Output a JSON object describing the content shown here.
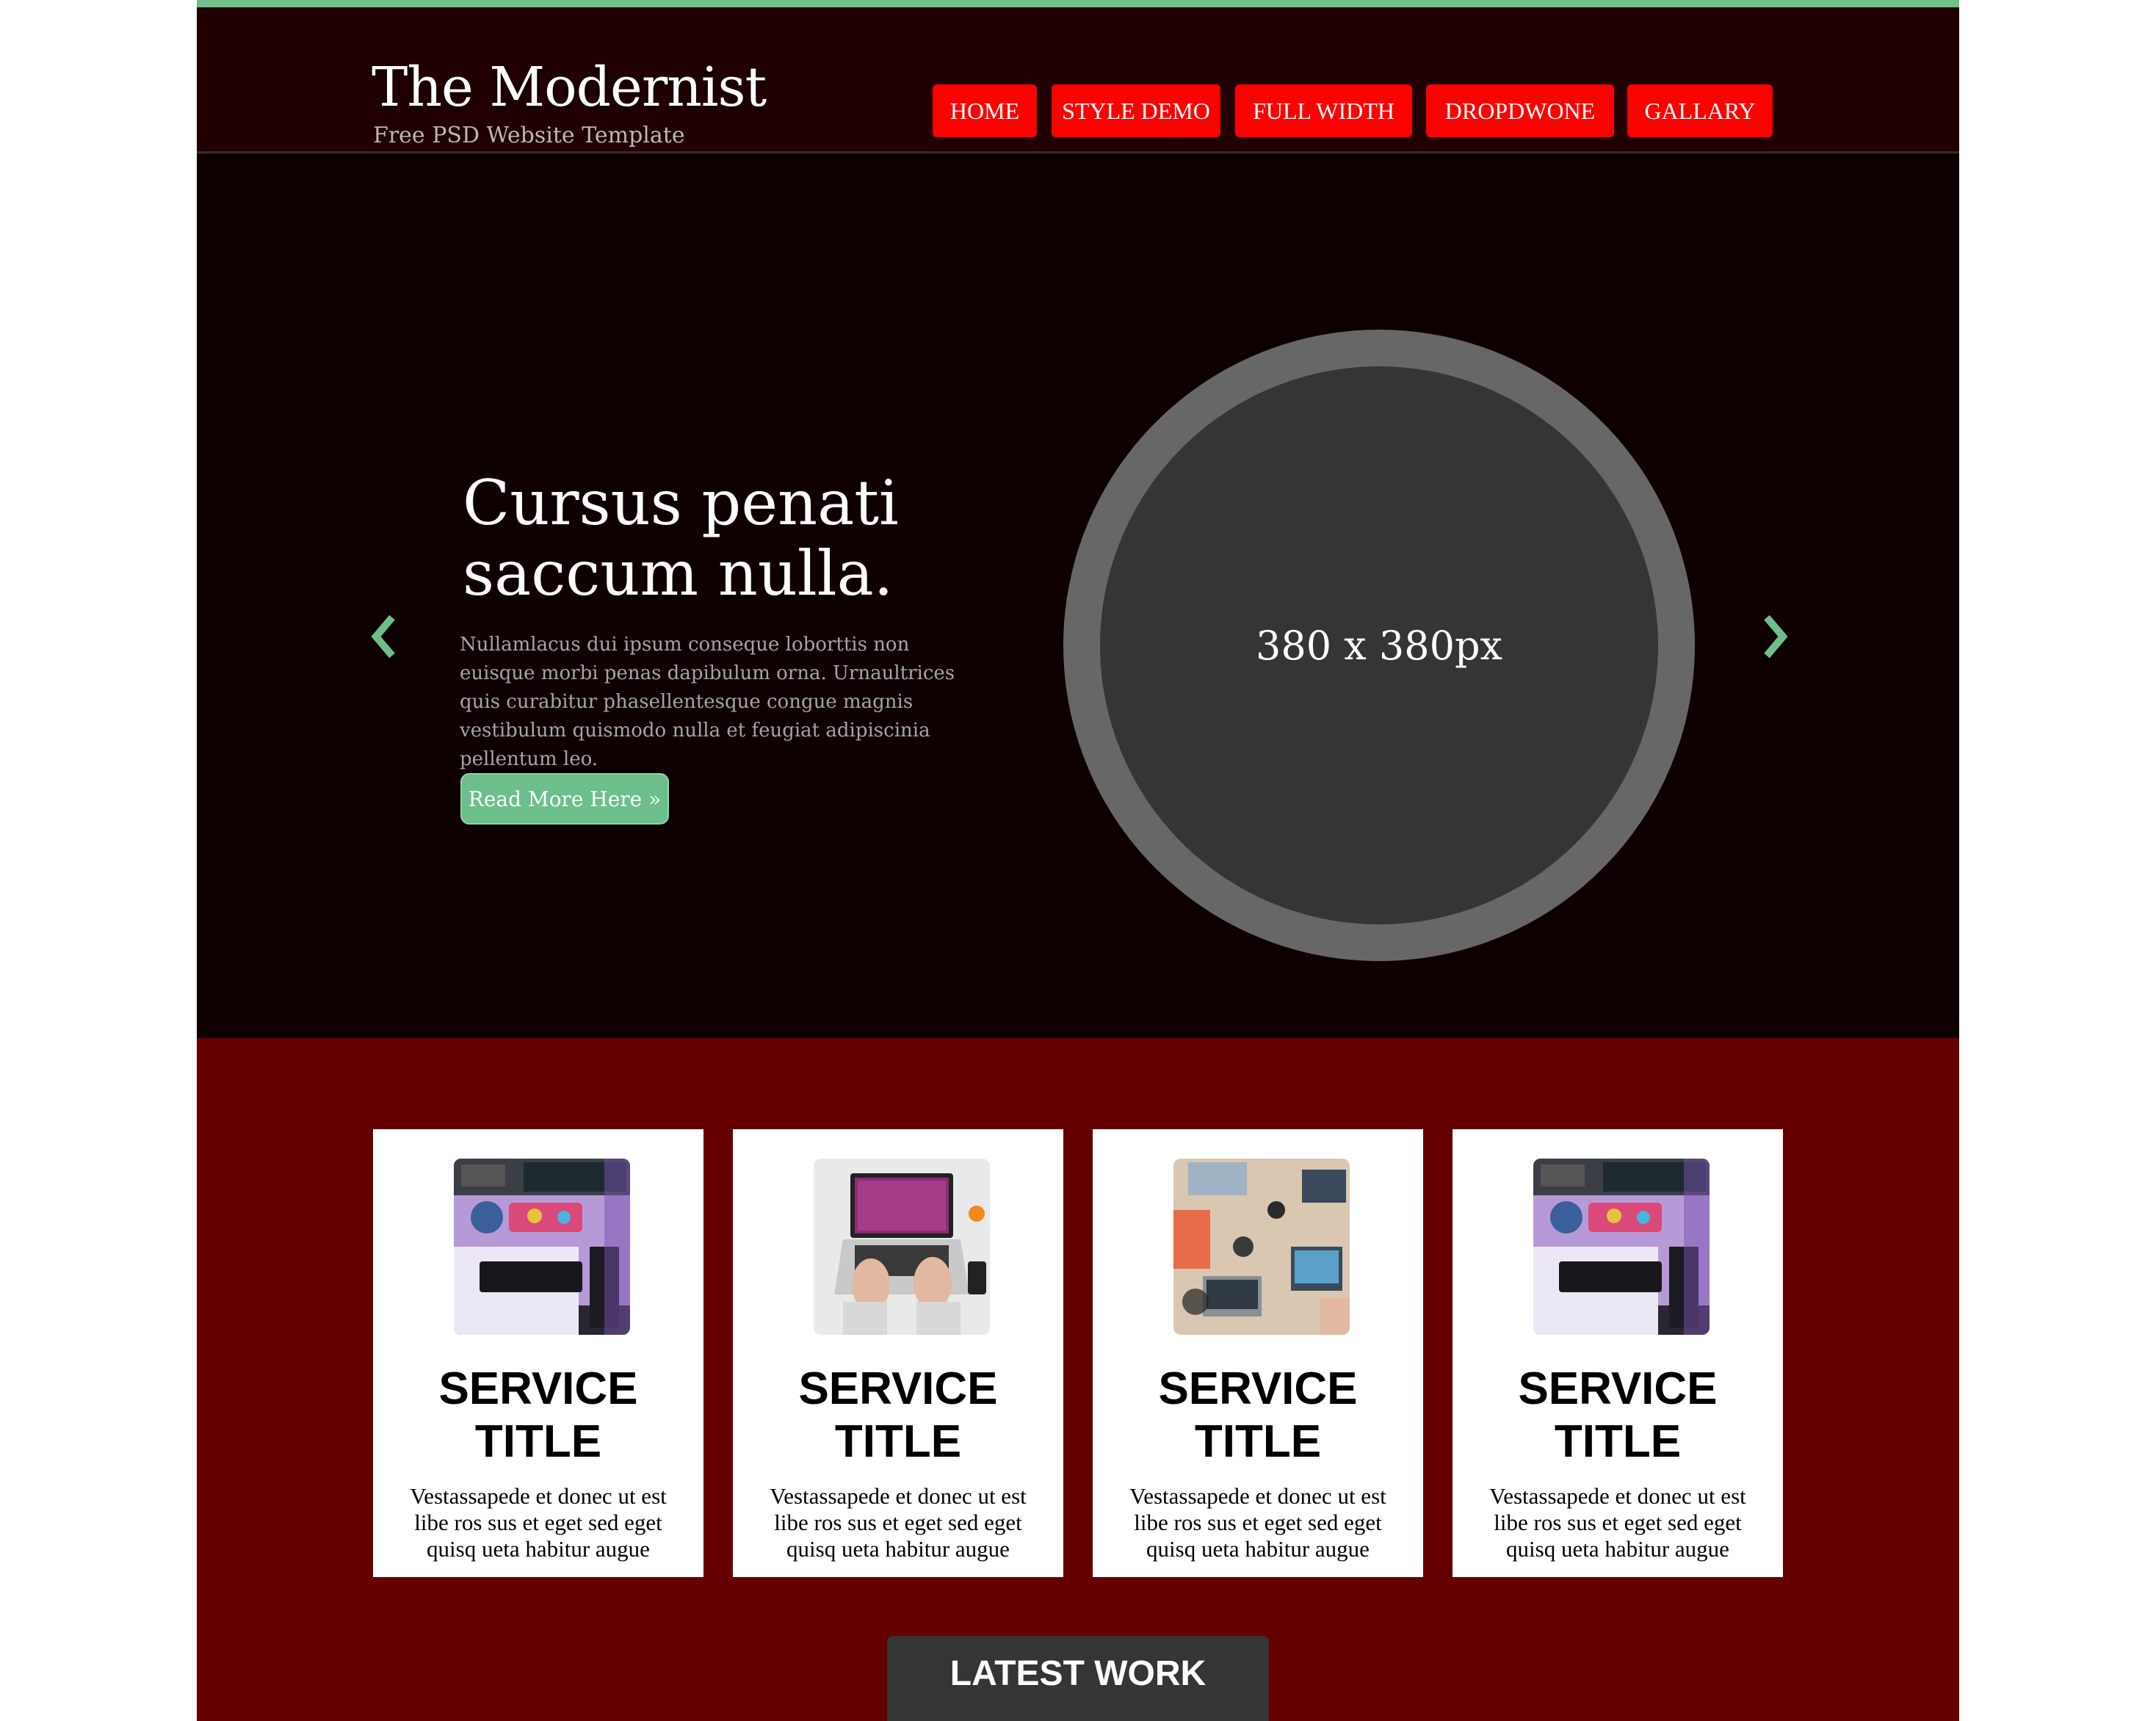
{
  "brand": {
    "title": "The Modernist",
    "tagline": "Free PSD Website Template"
  },
  "nav": {
    "items": [
      {
        "label": "HOME"
      },
      {
        "label": "STYLE DEMO"
      },
      {
        "label": "FULL WIDTH"
      },
      {
        "label": "DROPDWONE"
      },
      {
        "label": "GALLARY"
      }
    ]
  },
  "hero": {
    "title": "Cursus penati saccum nulla.",
    "text": "Nullamlacus dui ipsum conseque loborttis non euisque morbi penas dapibulum orna. Urnaultrices quis curabitur phasellentesque congue magnis vestibulum quismodo nulla et feugiat adipiscinia pellentum leo.",
    "button_label": "Read More Here »",
    "image_placeholder": "380 x 380px",
    "prev_icon": "chevron-left-icon",
    "next_icon": "chevron-right-icon"
  },
  "services": {
    "cards": [
      {
        "title": "SERVICE TITLE",
        "text": "Vestassapede et donec ut est libe ros sus et eget sed eget quisq ueta habitur augue",
        "image": "desk-keyboard-photo"
      },
      {
        "title": "SERVICE TITLE",
        "text": "Vestassapede et donec ut est libe ros sus et eget sed eget quisq ueta habitur augue",
        "image": "laptop-typing-photo"
      },
      {
        "title": "SERVICE TITLE",
        "text": "Vestassapede et donec ut est libe ros sus et eget sed eget quisq ueta habitur augue",
        "image": "team-desk-photo"
      },
      {
        "title": "SERVICE TITLE",
        "text": "Vestassapede et donec ut est libe ros sus et eget sed eget quisq ueta habitur augue",
        "image": "desk-keyboard-photo"
      }
    ]
  },
  "latest_work": {
    "label": "LATEST WORK"
  },
  "colors": {
    "accent_green": "#71bf8a",
    "nav_red": "#ff0000",
    "header_bg": "#200000",
    "hero_bg": "#0e0000",
    "services_bg": "#650000"
  }
}
